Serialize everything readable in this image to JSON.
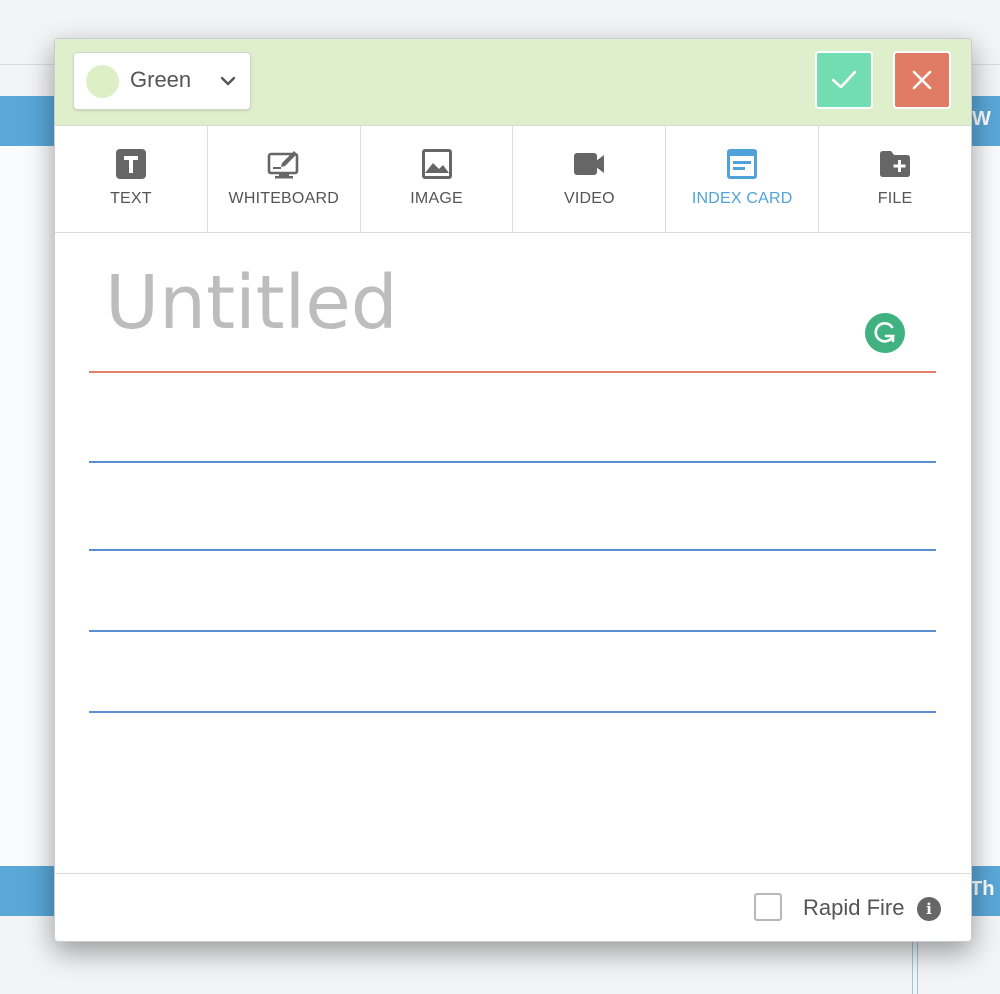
{
  "background": {
    "right_top_strip_text": "W",
    "right_bottom_strip_text": "Th"
  },
  "header": {
    "color_select": {
      "selected_label": "Green",
      "swatch_color": "#dcefc5"
    },
    "background_color": "#e0efcb",
    "confirm_button_color": "#72ddb0",
    "close_button_color": "#e07c66"
  },
  "tabs": [
    {
      "id": "text",
      "label": "TEXT",
      "icon": "text-icon",
      "active": false
    },
    {
      "id": "whiteboard",
      "label": "WHITEBOARD",
      "icon": "whiteboard-icon",
      "active": false
    },
    {
      "id": "image",
      "label": "IMAGE",
      "icon": "image-icon",
      "active": false
    },
    {
      "id": "video",
      "label": "VIDEO",
      "icon": "video-camera-icon",
      "active": false
    },
    {
      "id": "index_card",
      "label": "INDEX CARD",
      "icon": "index-card-icon",
      "active": true
    },
    {
      "id": "file",
      "label": "FILE",
      "icon": "folder-plus-icon",
      "active": false
    }
  ],
  "card": {
    "title_placeholder": "Untitled",
    "title_value": "",
    "accent_color": "#4fa3d8"
  },
  "footer": {
    "rapid_fire_label": "Rapid Fire",
    "rapid_fire_checked": false,
    "info_icon_glyph": "i"
  }
}
